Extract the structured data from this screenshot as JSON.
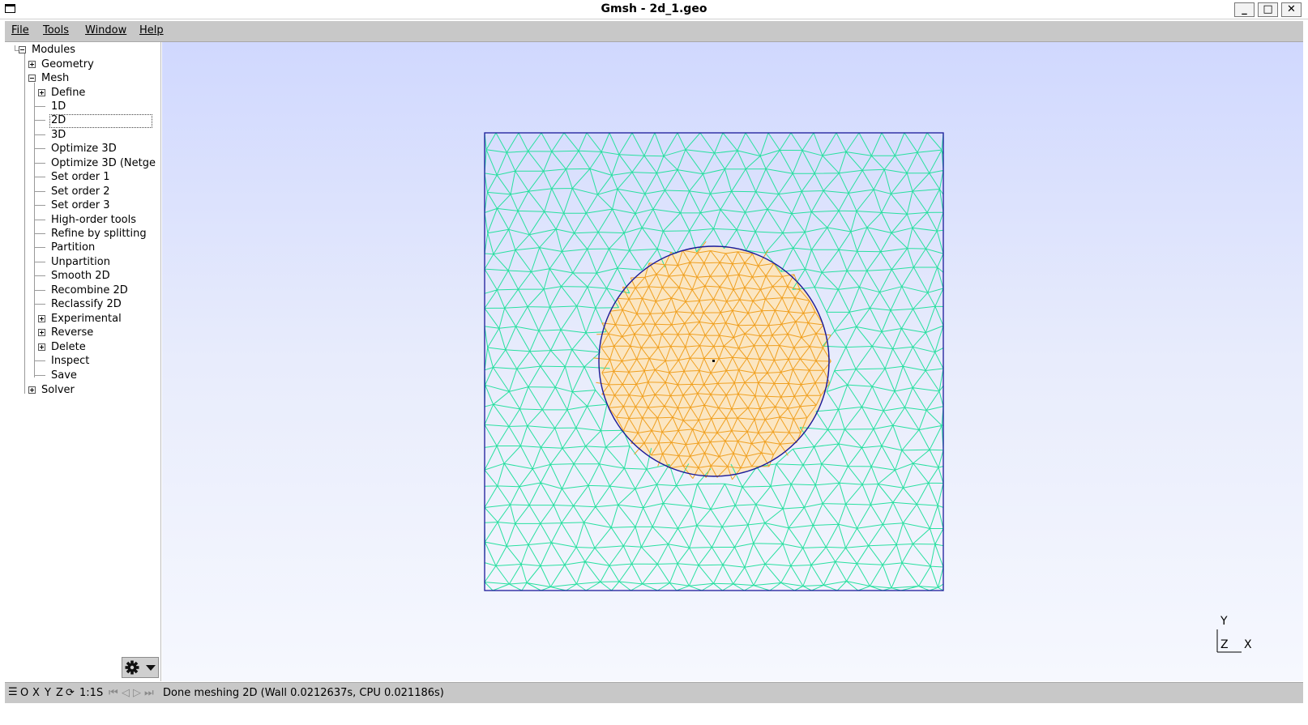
{
  "window": {
    "title": "Gmsh - 2d_1.geo",
    "minimize": "_",
    "maximize": "□",
    "close": "✕"
  },
  "menu": {
    "file": "File",
    "tools": "Tools",
    "window": "Window",
    "help": "Help"
  },
  "tree": {
    "root": "Modules",
    "geometry": "Geometry",
    "mesh": "Mesh",
    "mesh_items": [
      "Define",
      "1D",
      "2D",
      "3D",
      "Optimize 3D",
      "Optimize 3D (Netgen)",
      "Set order 1",
      "Set order 2",
      "Set order 3",
      "High-order tools",
      "Refine by splitting",
      "Partition",
      "Unpartition",
      "Smooth 2D",
      "Recombine 2D",
      "Reclassify 2D",
      "Experimental",
      "Reverse",
      "Delete",
      "Inspect",
      "Save"
    ],
    "solver": "Solver",
    "selected": "2D"
  },
  "axes": {
    "y": "Y",
    "z": "Z",
    "x": "X"
  },
  "status": {
    "o": "O",
    "x": "X",
    "y": "Y",
    "z": "Z",
    "scale": "1:1",
    "s": "S",
    "message": "Done meshing 2D (Wall 0.0212637s, CPU 0.021186s)"
  },
  "colors": {
    "outer_mesh": "#28e0a0",
    "inner_mesh": "#f0a020",
    "boundary": "#1a1a9a",
    "inner_fill": "#fbe6c2"
  }
}
